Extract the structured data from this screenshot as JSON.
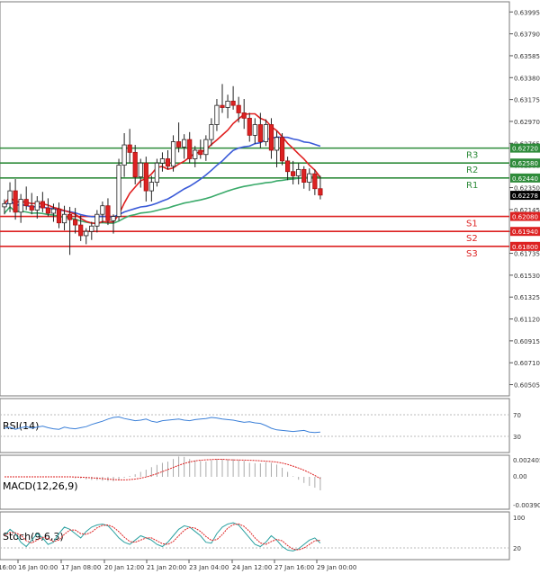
{
  "chart_data": {
    "type": "candlestick",
    "price_axis": {
      "ticks": [
        "0.63995",
        "0.63790",
        "0.63585",
        "0.63380",
        "0.63175",
        "0.62970",
        "0.62765",
        "0.62560",
        "0.62350",
        "0.62145",
        "0.61940",
        "0.61735",
        "0.61530",
        "0.61325",
        "0.61120",
        "0.60915",
        "0.60710",
        "0.60505"
      ],
      "tick_values": [
        0.63995,
        0.6379,
        0.63585,
        0.6338,
        0.63175,
        0.6297,
        0.62765,
        0.6256,
        0.6235,
        0.62145,
        0.6194,
        0.61735,
        0.6153,
        0.61325,
        0.6112,
        0.60915,
        0.6071,
        0.60505
      ],
      "range": [
        0.604,
        0.6409
      ]
    },
    "time_axis": {
      "labels": [
        "16:00",
        "16 Jan 00:00",
        "17 Jan 08:00",
        "20 Jan 12:00",
        "21 Jan 20:00",
        "23 Jan 04:00",
        "24 Jan 12:00",
        "27 Jan 16:00",
        "29 Jan 00:00"
      ]
    },
    "levels": [
      {
        "name": "R3",
        "value": 0.6272,
        "label": "0.62720",
        "color": "#2e8b3a"
      },
      {
        "name": "R2",
        "value": 0.6258,
        "label": "0.62580",
        "color": "#2e8b3a"
      },
      {
        "name": "R1",
        "value": 0.6244,
        "label": "0.62440",
        "color": "#2e8b3a"
      },
      {
        "name": "S1",
        "value": 0.6208,
        "label": "0.62080",
        "color": "#dd2222"
      },
      {
        "name": "S2",
        "value": 0.6194,
        "label": "0.61940",
        "color": "#dd2222"
      },
      {
        "name": "S3",
        "value": 0.618,
        "label": "0.61800",
        "color": "#dd2222"
      }
    ],
    "current_price": {
      "value": 0.62278,
      "label": "0.62278"
    },
    "candles": [
      [
        0.6217,
        0.6224,
        0.621,
        0.622
      ],
      [
        0.622,
        0.624,
        0.6212,
        0.6232
      ],
      [
        0.6232,
        0.6243,
        0.6205,
        0.6212
      ],
      [
        0.6212,
        0.6229,
        0.6202,
        0.6224
      ],
      [
        0.6224,
        0.6236,
        0.6214,
        0.6218
      ],
      [
        0.6218,
        0.623,
        0.621,
        0.6214
      ],
      [
        0.6214,
        0.6227,
        0.6206,
        0.6222
      ],
      [
        0.6222,
        0.6231,
        0.6212,
        0.6216
      ],
      [
        0.6216,
        0.6225,
        0.6208,
        0.6211
      ],
      [
        0.6211,
        0.622,
        0.6203,
        0.6215
      ],
      [
        0.6215,
        0.6221,
        0.6197,
        0.6202
      ],
      [
        0.6202,
        0.6218,
        0.6195,
        0.621
      ],
      [
        0.621,
        0.6217,
        0.6172,
        0.6205
      ],
      [
        0.6205,
        0.6216,
        0.6192,
        0.62
      ],
      [
        0.62,
        0.6209,
        0.6185,
        0.619
      ],
      [
        0.619,
        0.6197,
        0.6182,
        0.6194
      ],
      [
        0.6194,
        0.6203,
        0.6186,
        0.6199
      ],
      [
        0.6199,
        0.6214,
        0.6193,
        0.621
      ],
      [
        0.621,
        0.6222,
        0.6202,
        0.6218
      ],
      [
        0.6218,
        0.6225,
        0.62,
        0.6204
      ],
      [
        0.6204,
        0.621,
        0.6192,
        0.6208
      ],
      [
        0.6208,
        0.6262,
        0.6204,
        0.6256
      ],
      [
        0.6256,
        0.6286,
        0.6245,
        0.6275
      ],
      [
        0.6275,
        0.629,
        0.6258,
        0.6268
      ],
      [
        0.6268,
        0.6275,
        0.6238,
        0.6245
      ],
      [
        0.6245,
        0.6262,
        0.6235,
        0.6258
      ],
      [
        0.6258,
        0.6264,
        0.6222,
        0.6232
      ],
      [
        0.6232,
        0.6246,
        0.6222,
        0.624
      ],
      [
        0.624,
        0.6262,
        0.6236,
        0.6258
      ],
      [
        0.6258,
        0.6268,
        0.625,
        0.6262
      ],
      [
        0.6262,
        0.627,
        0.6252,
        0.6255
      ],
      [
        0.6255,
        0.6284,
        0.625,
        0.6278
      ],
      [
        0.6278,
        0.6296,
        0.6268,
        0.6273
      ],
      [
        0.6273,
        0.6285,
        0.6262,
        0.628
      ],
      [
        0.628,
        0.6287,
        0.6258,
        0.6262
      ],
      [
        0.6262,
        0.6274,
        0.6254,
        0.627
      ],
      [
        0.627,
        0.628,
        0.6262,
        0.6266
      ],
      [
        0.6266,
        0.6284,
        0.626,
        0.628
      ],
      [
        0.628,
        0.63,
        0.6274,
        0.6294
      ],
      [
        0.6294,
        0.6318,
        0.6288,
        0.6312
      ],
      [
        0.6312,
        0.6332,
        0.6305,
        0.631
      ],
      [
        0.631,
        0.6322,
        0.63,
        0.6316
      ],
      [
        0.6316,
        0.633,
        0.6308,
        0.6312
      ],
      [
        0.6312,
        0.632,
        0.6296,
        0.6305
      ],
      [
        0.6305,
        0.6318,
        0.629,
        0.63
      ],
      [
        0.63,
        0.6305,
        0.6278,
        0.6284
      ],
      [
        0.6284,
        0.63,
        0.6276,
        0.6294
      ],
      [
        0.6294,
        0.6305,
        0.6272,
        0.6278
      ],
      [
        0.6278,
        0.6299,
        0.6274,
        0.6294
      ],
      [
        0.6294,
        0.63,
        0.6262,
        0.627
      ],
      [
        0.627,
        0.6288,
        0.6254,
        0.6282
      ],
      [
        0.6282,
        0.6286,
        0.6256,
        0.626
      ],
      [
        0.626,
        0.6264,
        0.6242,
        0.625
      ],
      [
        0.625,
        0.626,
        0.6238,
        0.6246
      ],
      [
        0.6246,
        0.6258,
        0.6238,
        0.6252
      ],
      [
        0.6252,
        0.6255,
        0.6234,
        0.624
      ],
      [
        0.624,
        0.6253,
        0.6232,
        0.6248
      ],
      [
        0.6248,
        0.6252,
        0.6228,
        0.6234
      ],
      [
        0.6234,
        0.6246,
        0.6224,
        0.6228
      ]
    ],
    "indicators": [
      {
        "name": "RSI(14)",
        "levels": [
          "70",
          "30"
        ],
        "level_values": [
          70,
          30
        ],
        "range": [
          0,
          100
        ],
        "values": [
          45,
          47,
          43,
          46,
          48,
          45,
          47,
          49,
          46,
          44,
          43,
          47,
          45,
          44,
          46,
          48,
          52,
          55,
          58,
          62,
          65,
          66,
          63,
          61,
          59,
          60,
          62,
          58,
          56,
          59,
          60,
          61,
          62,
          60,
          59,
          61,
          62,
          63,
          65,
          64,
          62,
          61,
          60,
          58,
          56,
          57,
          55,
          54,
          50,
          45,
          42,
          41,
          40,
          39,
          40,
          41,
          38,
          37,
          38
        ]
      },
      {
        "name": "MACD(12,26,9)",
        "levels": [
          "0.002405",
          "0.00",
          "-0.003902"
        ],
        "level_values": [
          0.002405,
          0,
          -0.003902
        ],
        "range": [
          -0.0045,
          0.003
        ]
      },
      {
        "name": "Stoch(9,6,3)",
        "levels": [
          "100",
          "20"
        ],
        "level_values": [
          100,
          20
        ],
        "range": [
          0,
          110
        ],
        "values": [
          55,
          70,
          60,
          40,
          30,
          45,
          60,
          50,
          35,
          40,
          60,
          75,
          70,
          60,
          50,
          65,
          75,
          80,
          82,
          78,
          65,
          50,
          40,
          35,
          45,
          55,
          50,
          45,
          35,
          30,
          40,
          55,
          70,
          78,
          75,
          65,
          55,
          40,
          38,
          60,
          75,
          82,
          85,
          80,
          65,
          50,
          35,
          30,
          40,
          55,
          45,
          30,
          22,
          20,
          25,
          35,
          45,
          50,
          38
        ]
      }
    ]
  }
}
